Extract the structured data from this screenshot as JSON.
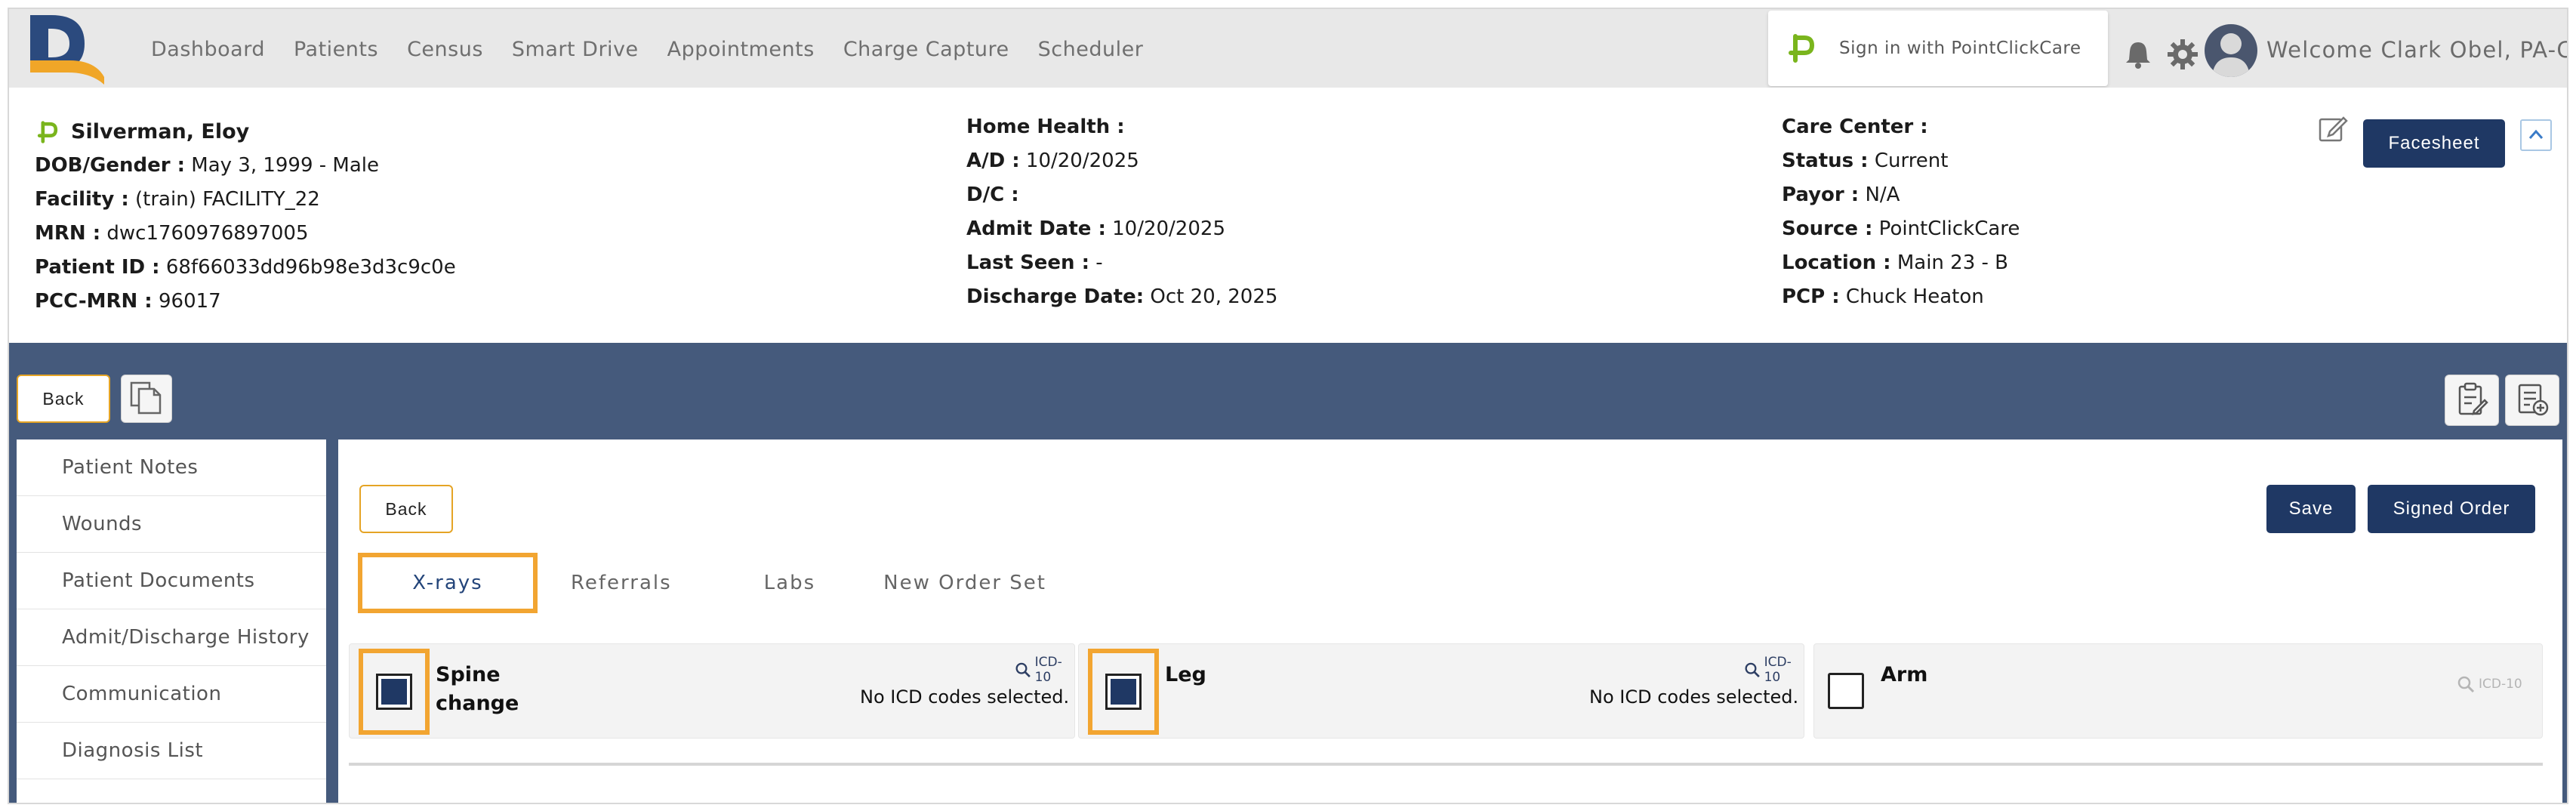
{
  "nav": {
    "items": [
      "Dashboard",
      "Patients",
      "Census",
      "Smart Drive",
      "Appointments",
      "Charge Capture",
      "Scheduler"
    ],
    "pcc_signin": "Sign in with PointClickCare",
    "welcome": "Welcome Clark Obel, PA-C"
  },
  "patient": {
    "name": "Silverman, Eloy",
    "left": [
      {
        "label": "DOB/Gender :",
        "value": " May 3, 1999 - Male"
      },
      {
        "label": "Facility :",
        "value": " (train) FACILITY_22"
      },
      {
        "label": "MRN :",
        "value": " dwc1760976897005"
      },
      {
        "label": "Patient ID :",
        "value": " 68f66033dd96b98e3d3c9c0e"
      },
      {
        "label": "PCC-MRN :",
        "value": " 96017"
      }
    ],
    "middle": [
      {
        "label": "Home Health :",
        "value": ""
      },
      {
        "label": "A/D :",
        "value": " 10/20/2025"
      },
      {
        "label": "D/C :",
        "value": ""
      },
      {
        "label": "Admit Date :",
        "value": " 10/20/2025"
      },
      {
        "label": "Last Seen :",
        "value": " -"
      },
      {
        "label": "Discharge Date:",
        "value": " Oct 20, 2025"
      }
    ],
    "right": [
      {
        "label": "Care Center :",
        "value": ""
      },
      {
        "label": "Status :",
        "value": " Current"
      },
      {
        "label": "Payor :",
        "value": " N/A"
      },
      {
        "label": "Source :",
        "value": " PointClickCare"
      },
      {
        "label": "Location :",
        "value": " Main 23 - B"
      },
      {
        "label": "PCP :",
        "value": " Chuck Heaton"
      }
    ],
    "facesheet_label": "Facesheet"
  },
  "toolbar": {
    "back_label": "Back"
  },
  "sidebar": {
    "items": [
      "Patient Notes",
      "Wounds",
      "Patient Documents",
      "Admit/Discharge History",
      "Communication",
      "Diagnosis List"
    ]
  },
  "main": {
    "back_label": "Back",
    "save_label": "Save",
    "signed_order_label": "Signed Order",
    "tabs": [
      "X-rays",
      "Referrals",
      "Labs",
      "New Order Set"
    ],
    "cards": [
      {
        "title_line1": "Spine",
        "title_line2": "change",
        "icd_label": "ICD-10",
        "no_icd": "No ICD codes selected."
      },
      {
        "title_line1": "Leg",
        "title_line2": "",
        "icd_label": "ICD-10",
        "no_icd": "No ICD codes selected."
      },
      {
        "title_line1": "Arm",
        "title_line2": "",
        "icd_label": "ICD-10",
        "no_icd": ""
      }
    ]
  },
  "colors": {
    "navy": "#1f3864",
    "accent_orange": "#f2a531",
    "background_blue": "#455a7c",
    "pcc_green": "#7ab51d"
  }
}
